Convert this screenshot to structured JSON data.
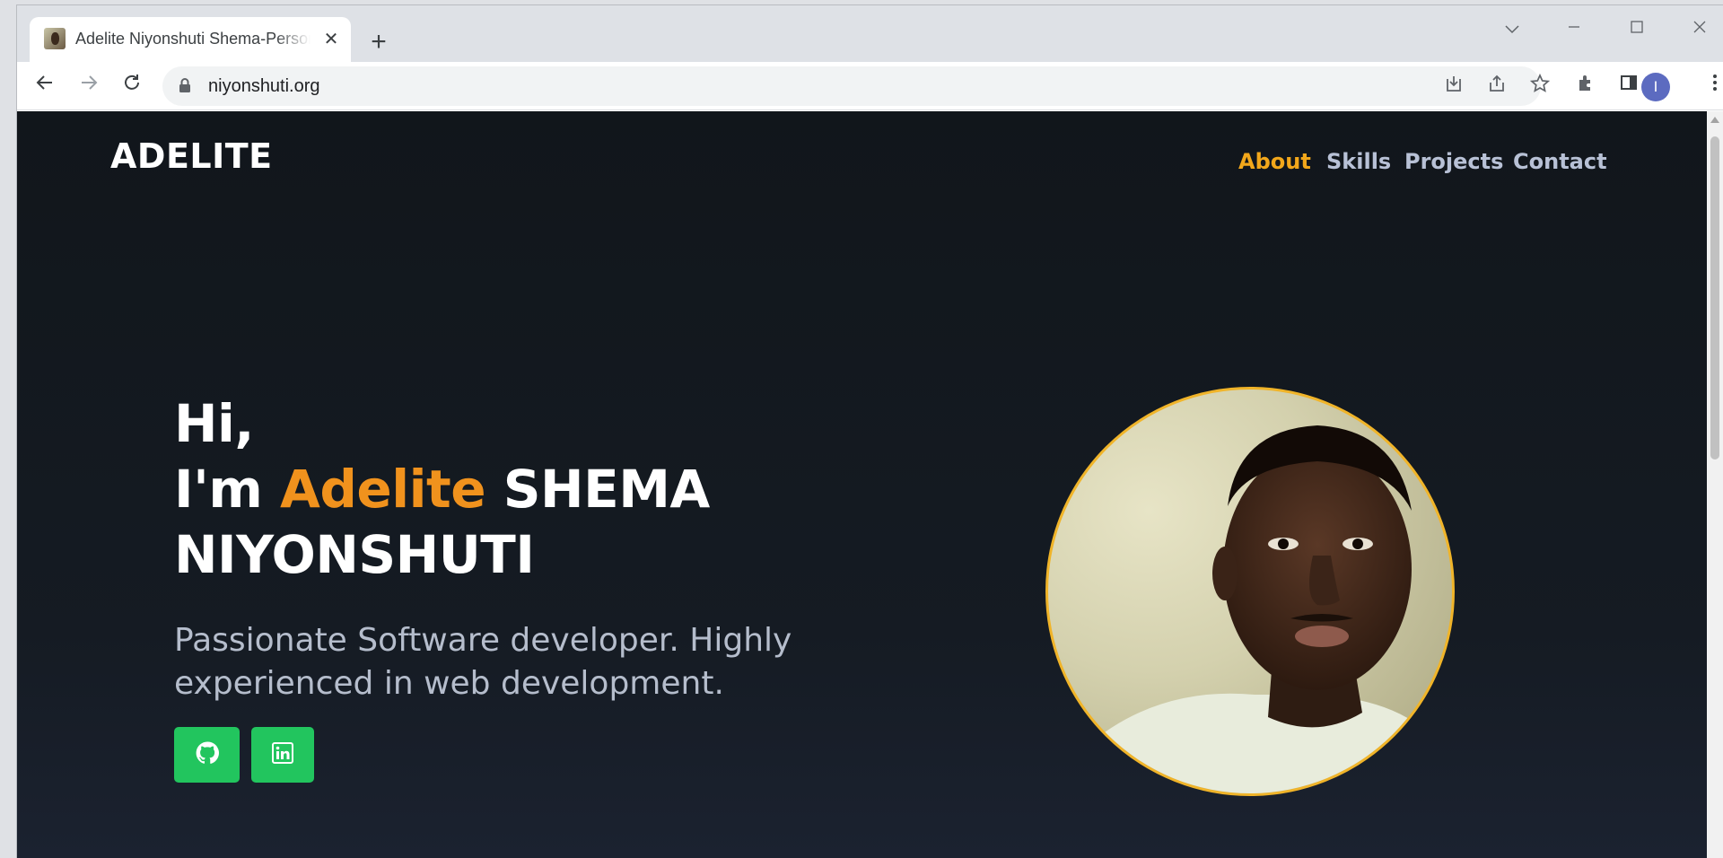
{
  "browser": {
    "tab_title": "Adelite Niyonshuti Shema-Personal Portfolio",
    "tab_close": "✕",
    "new_tab": "+",
    "url": "niyonshuti.org",
    "profile_initial": "I"
  },
  "site": {
    "logo": "ADELITE",
    "nav": [
      "About",
      "Skills",
      "Projects",
      "Contact"
    ],
    "nav_active_index": 0,
    "hero": {
      "greeting": "Hi,",
      "intro": "I'm",
      "first_name": "Adelite",
      "last_name_1": "SHEMA",
      "last_name_2": "NIYONSHUTI",
      "subtitle": "Passionate Software developer. Highly experienced in web development."
    },
    "social": [
      "github-icon",
      "linkedin-icon"
    ]
  },
  "colors": {
    "accent": "#f0921d",
    "nav_active": "#f2a71b",
    "button": "#22c55e",
    "background": "#11161b"
  }
}
